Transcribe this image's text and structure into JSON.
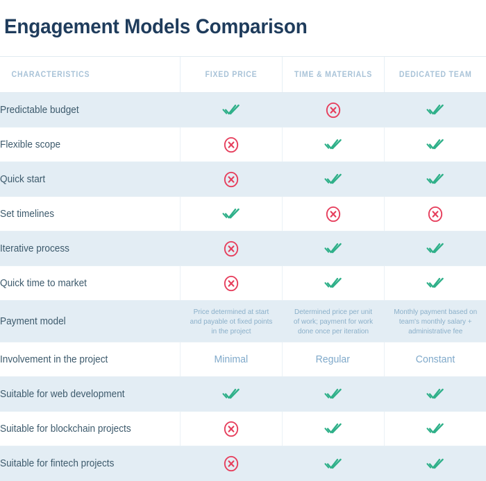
{
  "page": {
    "title": "Engagement Models Comparison"
  },
  "colors": {
    "title": "#1f3c5c",
    "header_text": "#a9c3d8",
    "row_label": "#3d5a6c",
    "shaded_row_bg": "#e3edf4",
    "plain_row_bg": "#ffffff",
    "check_green": "#2fb089",
    "cross_red": "#e63e5c",
    "note_text": "#8aafc9",
    "word_text": "#7fa9ca",
    "border": "#e6eff5"
  },
  "table": {
    "headers": [
      {
        "label": "CHARACTERISTICS",
        "align": "left"
      },
      {
        "label": "FIXED PRICE",
        "align": "center"
      },
      {
        "label": "TIME & MATERIALS",
        "align": "center"
      },
      {
        "label": "DEDICATED TEAM",
        "align": "center"
      }
    ],
    "rows": [
      {
        "characteristic": "Predictable budget",
        "shaded": true,
        "type": "icon",
        "values": [
          {
            "icon": "double-check-icon",
            "value": "yes"
          },
          {
            "icon": "circle-x-icon",
            "value": "no"
          },
          {
            "icon": "double-check-icon",
            "value": "yes"
          }
        ]
      },
      {
        "characteristic": "Flexible scope",
        "shaded": false,
        "type": "icon",
        "values": [
          {
            "icon": "circle-x-icon",
            "value": "no"
          },
          {
            "icon": "double-check-icon",
            "value": "yes"
          },
          {
            "icon": "double-check-icon",
            "value": "yes"
          }
        ]
      },
      {
        "characteristic": "Quick start",
        "shaded": true,
        "type": "icon",
        "values": [
          {
            "icon": "circle-x-icon",
            "value": "no"
          },
          {
            "icon": "double-check-icon",
            "value": "yes"
          },
          {
            "icon": "double-check-icon",
            "value": "yes"
          }
        ]
      },
      {
        "characteristic": "Set timelines",
        "shaded": false,
        "type": "icon",
        "values": [
          {
            "icon": "double-check-icon",
            "value": "yes"
          },
          {
            "icon": "circle-x-icon",
            "value": "no"
          },
          {
            "icon": "circle-x-icon",
            "value": "no"
          }
        ]
      },
      {
        "characteristic": "Iterative process",
        "shaded": true,
        "type": "icon",
        "values": [
          {
            "icon": "circle-x-icon",
            "value": "no"
          },
          {
            "icon": "double-check-icon",
            "value": "yes"
          },
          {
            "icon": "double-check-icon",
            "value": "yes"
          }
        ]
      },
      {
        "characteristic": "Quick time to market",
        "shaded": false,
        "type": "icon",
        "values": [
          {
            "icon": "circle-x-icon",
            "value": "no"
          },
          {
            "icon": "double-check-icon",
            "value": "yes"
          },
          {
            "icon": "double-check-icon",
            "value": "yes"
          }
        ]
      },
      {
        "characteristic": "Payment model",
        "shaded": true,
        "type": "note",
        "tall": true,
        "values": [
          {
            "text": "Price determined at start and payable ot fixed points in the project"
          },
          {
            "text": "Determined price per unit of work; payment for work done once per iteration"
          },
          {
            "text": "Monthly payment based on team's monthly salary + administrative fee"
          }
        ]
      },
      {
        "characteristic": "Involvement in the project",
        "shaded": false,
        "type": "word",
        "values": [
          {
            "text": "Minimal"
          },
          {
            "text": "Regular"
          },
          {
            "text": "Constant"
          }
        ]
      },
      {
        "characteristic": "Suitable for web development",
        "shaded": true,
        "type": "icon",
        "values": [
          {
            "icon": "double-check-icon",
            "value": "yes"
          },
          {
            "icon": "double-check-icon",
            "value": "yes"
          },
          {
            "icon": "double-check-icon",
            "value": "yes"
          }
        ]
      },
      {
        "characteristic": "Suitable for blockchain projects",
        "shaded": false,
        "type": "icon",
        "values": [
          {
            "icon": "circle-x-icon",
            "value": "no"
          },
          {
            "icon": "double-check-icon",
            "value": "yes"
          },
          {
            "icon": "double-check-icon",
            "value": "yes"
          }
        ]
      },
      {
        "characteristic": "Suitable for fintech projects",
        "shaded": true,
        "type": "icon",
        "values": [
          {
            "icon": "circle-x-icon",
            "value": "no"
          },
          {
            "icon": "double-check-icon",
            "value": "yes"
          },
          {
            "icon": "double-check-icon",
            "value": "yes"
          }
        ]
      }
    ]
  }
}
